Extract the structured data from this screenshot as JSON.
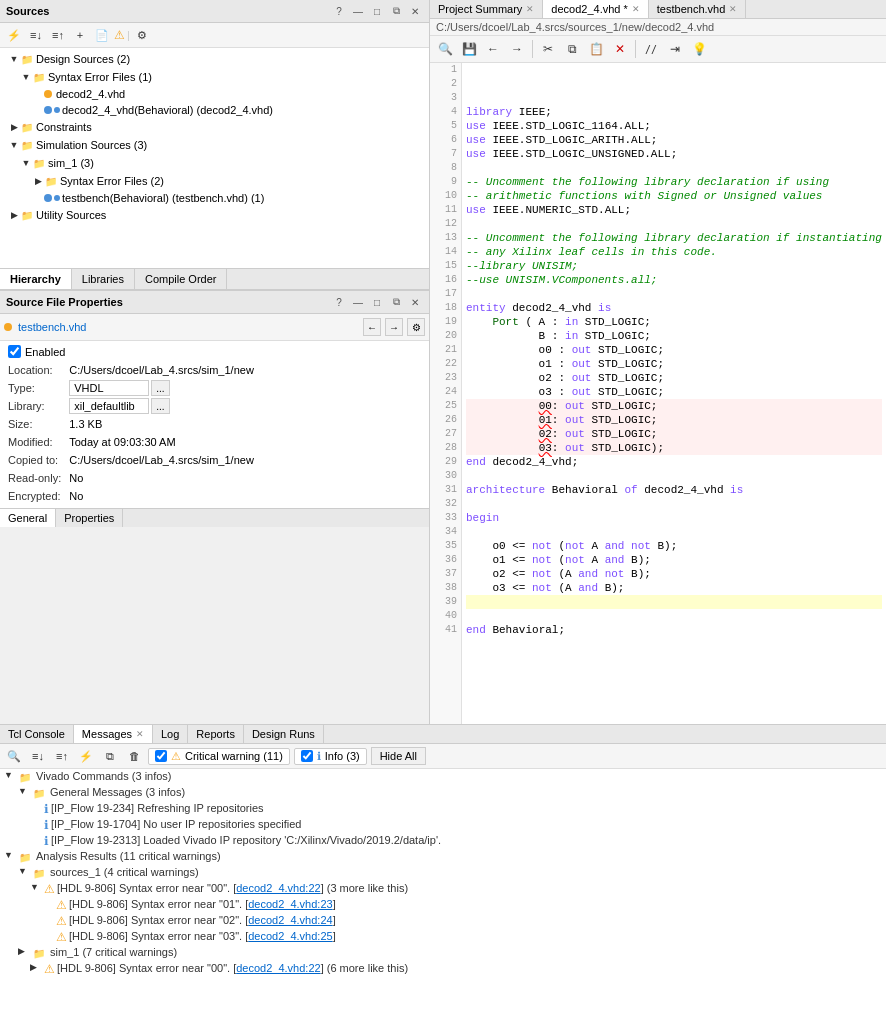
{
  "sources_panel": {
    "title": "Sources",
    "toolbar_icons": [
      "filter",
      "expand-all",
      "collapse-all",
      "add",
      "file",
      "warning",
      "more"
    ],
    "settings_icon": "⚙",
    "tree": [
      {
        "id": "design-sources",
        "label": "Design Sources (2)",
        "level": 0,
        "expanded": true,
        "type": "folder"
      },
      {
        "id": "syntax-error-files",
        "label": "Syntax Error Files (1)",
        "level": 1,
        "expanded": true,
        "type": "folder"
      },
      {
        "id": "decod2_4_vhd",
        "label": "decod2_4.vhd",
        "level": 2,
        "expanded": false,
        "type": "file",
        "dot": "orange"
      },
      {
        "id": "decod2_4_vhd_behavioral",
        "label": "decod2_4_vhd(Behavioral) (decod2_4.vhd)",
        "level": 2,
        "expanded": false,
        "type": "file",
        "dot": "blue"
      },
      {
        "id": "constraints",
        "label": "Constraints",
        "level": 0,
        "expanded": false,
        "type": "folder"
      },
      {
        "id": "simulation-sources",
        "label": "Simulation Sources (3)",
        "level": 0,
        "expanded": true,
        "type": "folder"
      },
      {
        "id": "sim_1",
        "label": "sim_1 (3)",
        "level": 1,
        "expanded": true,
        "type": "folder"
      },
      {
        "id": "syntax-error-files-2",
        "label": "Syntax Error Files (2)",
        "level": 2,
        "expanded": false,
        "type": "folder"
      },
      {
        "id": "testbench",
        "label": "testbench(Behavioral) (testbench.vhd) (1)",
        "level": 2,
        "expanded": false,
        "type": "file",
        "dot": "blue"
      },
      {
        "id": "utility-sources",
        "label": "Utility Sources",
        "level": 0,
        "expanded": false,
        "type": "folder"
      }
    ],
    "tabs": [
      "Hierarchy",
      "Libraries",
      "Compile Order"
    ],
    "active_tab": "Hierarchy"
  },
  "sfp_panel": {
    "title": "Source File Properties",
    "filename": "testbench.vhd",
    "enabled": true,
    "location": "C:/Users/dcoel/Lab_4.srcs/sim_1/new",
    "type": "VHDL",
    "library": "xil_defaultlib",
    "size": "1.3 KB",
    "modified": "Today at 09:03:30 AM",
    "copied_to": "C:/Users/dcoel/Lab_4.srcs/sim_1/new",
    "read_only": "No",
    "encrypted": "No",
    "tabs": [
      "General",
      "Properties"
    ],
    "active_tab": "General"
  },
  "editor": {
    "tabs": [
      {
        "label": "Project Summary",
        "active": false,
        "closeable": false
      },
      {
        "label": "decod2_4.vhd *",
        "active": true,
        "closeable": true
      },
      {
        "label": "testbench.vhd",
        "active": false,
        "closeable": true
      }
    ],
    "path": "C:/Users/dcoel/Lab_4.srcs/sources_1/new/decod2_4.vhd",
    "lines": [
      {
        "num": 1,
        "content": "",
        "type": "normal"
      },
      {
        "num": 2,
        "content": "",
        "type": "normal"
      },
      {
        "num": 3,
        "content": "",
        "type": "normal"
      },
      {
        "num": 4,
        "content": "library IEEE;",
        "type": "normal"
      },
      {
        "num": 5,
        "content": "use IEEE.STD_LOGIC_1164.ALL;",
        "type": "normal"
      },
      {
        "num": 6,
        "content": "use IEEE.STD_LOGIC_ARITH.ALL;",
        "type": "normal"
      },
      {
        "num": 7,
        "content": "use IEEE.STD_LOGIC_UNSIGNED.ALL;",
        "type": "normal"
      },
      {
        "num": 8,
        "content": "",
        "type": "normal"
      },
      {
        "num": 9,
        "content": "-- Uncomment the following library declaration if using",
        "type": "normal"
      },
      {
        "num": 10,
        "content": "-- arithmetic functions with Signed or Unsigned values",
        "type": "normal"
      },
      {
        "num": 11,
        "content": "use IEEE.NUMERIC_STD.ALL;",
        "type": "normal"
      },
      {
        "num": 12,
        "content": "",
        "type": "normal"
      },
      {
        "num": 13,
        "content": "-- Uncomment the following library declaration if instantiating",
        "type": "normal"
      },
      {
        "num": 14,
        "content": "-- any Xilinx leaf cells in this code.",
        "type": "normal"
      },
      {
        "num": 15,
        "content": "--library UNISIM;",
        "type": "normal"
      },
      {
        "num": 16,
        "content": "--use UNISIM.VComponents.all;",
        "type": "normal"
      },
      {
        "num": 17,
        "content": "",
        "type": "normal"
      },
      {
        "num": 18,
        "content": "entity decod2_4_vhd is",
        "type": "normal"
      },
      {
        "num": 19,
        "content": "    Port ( A : in STD_LOGIC;",
        "type": "normal"
      },
      {
        "num": 20,
        "content": "           B : in STD_LOGIC;",
        "type": "normal"
      },
      {
        "num": 21,
        "content": "           o0 : out STD_LOGIC;",
        "type": "normal"
      },
      {
        "num": 22,
        "content": "           o1 : out STD_LOGIC;",
        "type": "normal"
      },
      {
        "num": 23,
        "content": "           o2 : out STD_LOGIC;",
        "type": "normal"
      },
      {
        "num": 24,
        "content": "           o3 : out STD_LOGIC;",
        "type": "normal"
      },
      {
        "num": 25,
        "content": "           00 : out STD_LOGIC;",
        "type": "error"
      },
      {
        "num": 26,
        "content": "           01 : out STD_LOGIC;",
        "type": "error"
      },
      {
        "num": 27,
        "content": "           02 : out STD_LOGIC;",
        "type": "error"
      },
      {
        "num": 28,
        "content": "           03 : out STD_LOGIC);",
        "type": "error"
      },
      {
        "num": 29,
        "content": "end decod2_4_vhd;",
        "type": "normal"
      },
      {
        "num": 30,
        "content": "",
        "type": "normal"
      },
      {
        "num": 31,
        "content": "architecture Behavioral of decod2_4_vhd is",
        "type": "normal"
      },
      {
        "num": 32,
        "content": "",
        "type": "normal"
      },
      {
        "num": 33,
        "content": "begin",
        "type": "normal"
      },
      {
        "num": 34,
        "content": "",
        "type": "normal"
      },
      {
        "num": 35,
        "content": "    o0 <= not (not A and not B);",
        "type": "normal"
      },
      {
        "num": 36,
        "content": "    o1 <= not (not A and B);",
        "type": "normal"
      },
      {
        "num": 37,
        "content": "    o2 <= not (A and not B);",
        "type": "normal"
      },
      {
        "num": 38,
        "content": "    o3 <= not (A and B);",
        "type": "normal"
      },
      {
        "num": 39,
        "content": "",
        "type": "highlighted"
      },
      {
        "num": 40,
        "content": "",
        "type": "normal"
      },
      {
        "num": 41,
        "content": "end Behavioral;",
        "type": "normal"
      }
    ]
  },
  "console": {
    "tabs": [
      {
        "label": "Tcl Console",
        "active": false
      },
      {
        "label": "Messages",
        "active": true,
        "closeable": true
      },
      {
        "label": "Log",
        "active": false
      },
      {
        "label": "Reports",
        "active": false
      },
      {
        "label": "Design Runs",
        "active": false
      }
    ],
    "filters": {
      "critical_warning": {
        "checked": true,
        "label": "Critical warning (11)"
      },
      "info": {
        "checked": true,
        "label": "Info (3)"
      }
    },
    "hide_all_label": "Hide All",
    "messages": [
      {
        "id": "vivado-cmds",
        "level": 0,
        "expanded": true,
        "label": "Vivado Commands (3 infos)",
        "type": "group"
      },
      {
        "id": "general-msgs",
        "level": 1,
        "expanded": true,
        "label": "General Messages (3 infos)",
        "type": "group"
      },
      {
        "id": "ip-flow-1",
        "level": 2,
        "expanded": false,
        "label": "[IP_Flow 19-234] Refreshing IP repositories",
        "type": "info"
      },
      {
        "id": "ip-flow-2",
        "level": 2,
        "expanded": false,
        "label": "[IP_Flow 19-1704] No user IP repositories specified",
        "type": "info"
      },
      {
        "id": "ip-flow-3",
        "level": 2,
        "expanded": false,
        "label": "[IP_Flow 19-2313] Loaded Vivado IP repository 'C:/Xilinx/Vivado/2019.2/data/ip'.",
        "type": "info"
      },
      {
        "id": "analysis-results",
        "level": 0,
        "expanded": true,
        "label": "Analysis Results (11 critical warnings)",
        "type": "group"
      },
      {
        "id": "sources-1",
        "level": 1,
        "expanded": true,
        "label": "sources_1 (4 critical warnings)",
        "type": "group"
      },
      {
        "id": "hdl-806-00",
        "level": 2,
        "expanded": true,
        "label": "[HDL 9-806] Syntax error near \"00\". [decod2_4.vhd:22] (3 more like this)",
        "type": "warning",
        "link": "decod2_4.vhd:22",
        "link_text": "decod2_4.vhd:22"
      },
      {
        "id": "hdl-806-01",
        "level": 3,
        "expanded": false,
        "label": "[HDL 9-806] Syntax error near \"01\". [decod2_4.vhd:23]",
        "type": "warning",
        "link": "decod2_4.vhd:23",
        "link_text": "decod2_4.vhd:23"
      },
      {
        "id": "hdl-806-02",
        "level": 3,
        "expanded": false,
        "label": "[HDL 9-806] Syntax error near \"02\". [decod2_4.vhd:24]",
        "type": "warning",
        "link": "decod2_4.vhd:24",
        "link_text": "decod2_4.vhd:24"
      },
      {
        "id": "hdl-806-03",
        "level": 3,
        "expanded": false,
        "label": "[HDL 9-806] Syntax error near \"03\". [decod2_4.vhd:25]",
        "type": "warning",
        "link": "decod2_4.vhd:25",
        "link_text": "decod2_4.vhd:25"
      },
      {
        "id": "sim-1-group",
        "level": 1,
        "expanded": false,
        "label": "sim_1 (7 critical warnings)",
        "type": "group"
      },
      {
        "id": "hdl-806-sim",
        "level": 2,
        "expanded": false,
        "label": "[HDL 9-806] Syntax error near \"00\". [decod2_4.vhd:22] (6 more like this)",
        "type": "warning",
        "link": "decod2_4.vhd:22",
        "link_text": "decod2_4.vhd:22"
      }
    ]
  },
  "icons": {
    "search": "🔍",
    "save": "💾",
    "back": "←",
    "forward": "→",
    "cut": "✂",
    "copy": "⧉",
    "paste": "📋",
    "delete": "✕",
    "comment": "//",
    "indent": "⇥",
    "info": "ℹ"
  }
}
